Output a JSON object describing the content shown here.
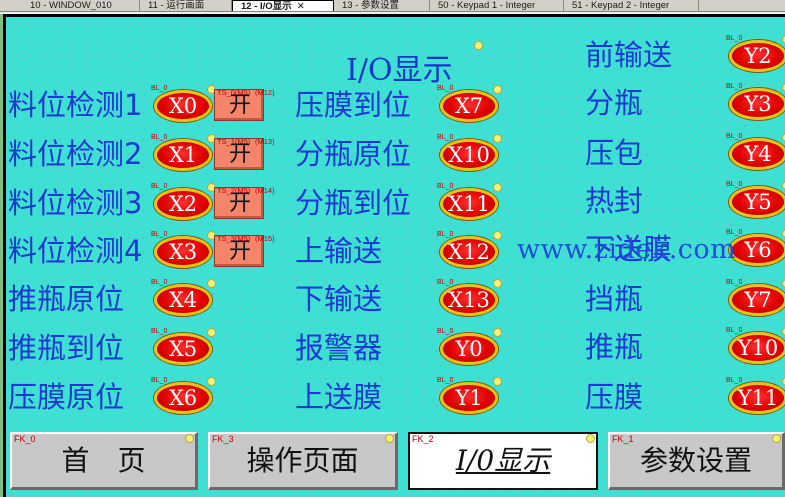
{
  "tabs": [
    {
      "label": "10 - WINDOW_010"
    },
    {
      "label": "11 - 运行画面"
    },
    {
      "label": "12 - I/O显示",
      "active": true
    },
    {
      "label": "13 - 参数设置"
    },
    {
      "label": "50 - Keypad 1 - Integer"
    },
    {
      "label": "51 - Keypad 2 - Integer"
    }
  ],
  "title": "I/O显示",
  "inputs_col1": [
    {
      "label": "料位检测1",
      "code": "X0",
      "switch": "开",
      "switch_tag": "TS_0(M5)",
      "switch_addr": "(M12)"
    },
    {
      "label": "料位检测2",
      "code": "X1",
      "switch": "开",
      "switch_tag": "TS_1(M5)",
      "switch_addr": "(M13)"
    },
    {
      "label": "料位检测3",
      "code": "X2",
      "switch": "开",
      "switch_tag": "TS_2(M5)",
      "switch_addr": "(M14)"
    },
    {
      "label": "料位检测4",
      "code": "X3",
      "switch": "开",
      "switch_tag": "TS_3(M5)",
      "switch_addr": "(M15)"
    },
    {
      "label": "推瓶原位",
      "code": "X4"
    },
    {
      "label": "推瓶到位",
      "code": "X5"
    },
    {
      "label": "压膜原位",
      "code": "X6"
    }
  ],
  "inputs_col2": [
    {
      "label": "压膜到位",
      "code": "X7"
    },
    {
      "label": "分瓶原位",
      "code": "X10"
    },
    {
      "label": "分瓶到位",
      "code": "X11"
    },
    {
      "label": "上输送",
      "code": "X12"
    },
    {
      "label": "下输送",
      "code": "X13"
    },
    {
      "label": "报警器",
      "code": "Y0"
    },
    {
      "label": "上送膜",
      "code": "Y1"
    }
  ],
  "outputs_col3": [
    {
      "label": "前输送",
      "code": "Y2"
    },
    {
      "label": "分瓶",
      "code": "Y3"
    },
    {
      "label": "压包",
      "code": "Y4"
    },
    {
      "label": "热封",
      "code": "Y5"
    },
    {
      "label": "下送膜",
      "code": "Y6"
    },
    {
      "label": "挡瓶",
      "code": "Y7"
    },
    {
      "label": "推瓶",
      "code": "Y10"
    },
    {
      "label": "压膜",
      "code": "Y11"
    }
  ],
  "lamp_tag": "BL_0",
  "watermark": "www.zidek.com",
  "function_keys": [
    {
      "tag": "FK_0",
      "label": "首　页"
    },
    {
      "tag": "FK_3",
      "label": "操作页面"
    },
    {
      "tag": "FK_2",
      "label": "I/0显示",
      "active": true
    },
    {
      "tag": "FK_1",
      "label": "参数设置"
    }
  ],
  "colors": {
    "background": "#3fe0d4",
    "label": "#1b3bd0",
    "lamp": "#e00000",
    "lamp_ring": "#e6c21a",
    "switch": "#f4846a"
  }
}
